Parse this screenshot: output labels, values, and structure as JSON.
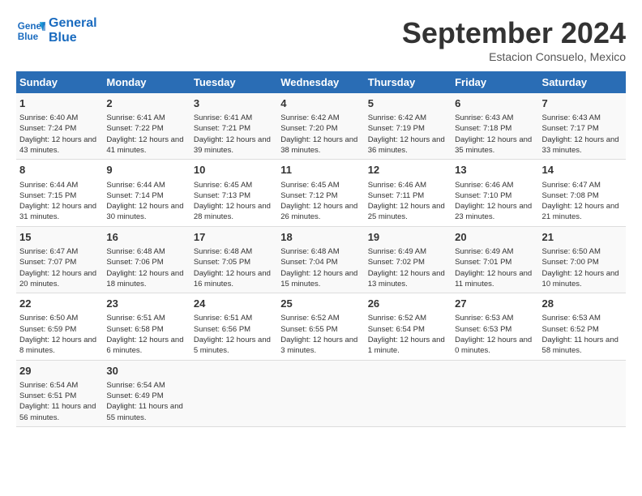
{
  "header": {
    "logo_line1": "General",
    "logo_line2": "Blue",
    "month": "September 2024",
    "location": "Estacion Consuelo, Mexico"
  },
  "weekdays": [
    "Sunday",
    "Monday",
    "Tuesday",
    "Wednesday",
    "Thursday",
    "Friday",
    "Saturday"
  ],
  "weeks": [
    [
      {
        "day": "1",
        "sunrise": "Sunrise: 6:40 AM",
        "sunset": "Sunset: 7:24 PM",
        "daylight": "Daylight: 12 hours and 43 minutes."
      },
      {
        "day": "2",
        "sunrise": "Sunrise: 6:41 AM",
        "sunset": "Sunset: 7:22 PM",
        "daylight": "Daylight: 12 hours and 41 minutes."
      },
      {
        "day": "3",
        "sunrise": "Sunrise: 6:41 AM",
        "sunset": "Sunset: 7:21 PM",
        "daylight": "Daylight: 12 hours and 39 minutes."
      },
      {
        "day": "4",
        "sunrise": "Sunrise: 6:42 AM",
        "sunset": "Sunset: 7:20 PM",
        "daylight": "Daylight: 12 hours and 38 minutes."
      },
      {
        "day": "5",
        "sunrise": "Sunrise: 6:42 AM",
        "sunset": "Sunset: 7:19 PM",
        "daylight": "Daylight: 12 hours and 36 minutes."
      },
      {
        "day": "6",
        "sunrise": "Sunrise: 6:43 AM",
        "sunset": "Sunset: 7:18 PM",
        "daylight": "Daylight: 12 hours and 35 minutes."
      },
      {
        "day": "7",
        "sunrise": "Sunrise: 6:43 AM",
        "sunset": "Sunset: 7:17 PM",
        "daylight": "Daylight: 12 hours and 33 minutes."
      }
    ],
    [
      {
        "day": "8",
        "sunrise": "Sunrise: 6:44 AM",
        "sunset": "Sunset: 7:15 PM",
        "daylight": "Daylight: 12 hours and 31 minutes."
      },
      {
        "day": "9",
        "sunrise": "Sunrise: 6:44 AM",
        "sunset": "Sunset: 7:14 PM",
        "daylight": "Daylight: 12 hours and 30 minutes."
      },
      {
        "day": "10",
        "sunrise": "Sunrise: 6:45 AM",
        "sunset": "Sunset: 7:13 PM",
        "daylight": "Daylight: 12 hours and 28 minutes."
      },
      {
        "day": "11",
        "sunrise": "Sunrise: 6:45 AM",
        "sunset": "Sunset: 7:12 PM",
        "daylight": "Daylight: 12 hours and 26 minutes."
      },
      {
        "day": "12",
        "sunrise": "Sunrise: 6:46 AM",
        "sunset": "Sunset: 7:11 PM",
        "daylight": "Daylight: 12 hours and 25 minutes."
      },
      {
        "day": "13",
        "sunrise": "Sunrise: 6:46 AM",
        "sunset": "Sunset: 7:10 PM",
        "daylight": "Daylight: 12 hours and 23 minutes."
      },
      {
        "day": "14",
        "sunrise": "Sunrise: 6:47 AM",
        "sunset": "Sunset: 7:08 PM",
        "daylight": "Daylight: 12 hours and 21 minutes."
      }
    ],
    [
      {
        "day": "15",
        "sunrise": "Sunrise: 6:47 AM",
        "sunset": "Sunset: 7:07 PM",
        "daylight": "Daylight: 12 hours and 20 minutes."
      },
      {
        "day": "16",
        "sunrise": "Sunrise: 6:48 AM",
        "sunset": "Sunset: 7:06 PM",
        "daylight": "Daylight: 12 hours and 18 minutes."
      },
      {
        "day": "17",
        "sunrise": "Sunrise: 6:48 AM",
        "sunset": "Sunset: 7:05 PM",
        "daylight": "Daylight: 12 hours and 16 minutes."
      },
      {
        "day": "18",
        "sunrise": "Sunrise: 6:48 AM",
        "sunset": "Sunset: 7:04 PM",
        "daylight": "Daylight: 12 hours and 15 minutes."
      },
      {
        "day": "19",
        "sunrise": "Sunrise: 6:49 AM",
        "sunset": "Sunset: 7:02 PM",
        "daylight": "Daylight: 12 hours and 13 minutes."
      },
      {
        "day": "20",
        "sunrise": "Sunrise: 6:49 AM",
        "sunset": "Sunset: 7:01 PM",
        "daylight": "Daylight: 12 hours and 11 minutes."
      },
      {
        "day": "21",
        "sunrise": "Sunrise: 6:50 AM",
        "sunset": "Sunset: 7:00 PM",
        "daylight": "Daylight: 12 hours and 10 minutes."
      }
    ],
    [
      {
        "day": "22",
        "sunrise": "Sunrise: 6:50 AM",
        "sunset": "Sunset: 6:59 PM",
        "daylight": "Daylight: 12 hours and 8 minutes."
      },
      {
        "day": "23",
        "sunrise": "Sunrise: 6:51 AM",
        "sunset": "Sunset: 6:58 PM",
        "daylight": "Daylight: 12 hours and 6 minutes."
      },
      {
        "day": "24",
        "sunrise": "Sunrise: 6:51 AM",
        "sunset": "Sunset: 6:56 PM",
        "daylight": "Daylight: 12 hours and 5 minutes."
      },
      {
        "day": "25",
        "sunrise": "Sunrise: 6:52 AM",
        "sunset": "Sunset: 6:55 PM",
        "daylight": "Daylight: 12 hours and 3 minutes."
      },
      {
        "day": "26",
        "sunrise": "Sunrise: 6:52 AM",
        "sunset": "Sunset: 6:54 PM",
        "daylight": "Daylight: 12 hours and 1 minute."
      },
      {
        "day": "27",
        "sunrise": "Sunrise: 6:53 AM",
        "sunset": "Sunset: 6:53 PM",
        "daylight": "Daylight: 12 hours and 0 minutes."
      },
      {
        "day": "28",
        "sunrise": "Sunrise: 6:53 AM",
        "sunset": "Sunset: 6:52 PM",
        "daylight": "Daylight: 11 hours and 58 minutes."
      }
    ],
    [
      {
        "day": "29",
        "sunrise": "Sunrise: 6:54 AM",
        "sunset": "Sunset: 6:51 PM",
        "daylight": "Daylight: 11 hours and 56 minutes."
      },
      {
        "day": "30",
        "sunrise": "Sunrise: 6:54 AM",
        "sunset": "Sunset: 6:49 PM",
        "daylight": "Daylight: 11 hours and 55 minutes."
      },
      null,
      null,
      null,
      null,
      null
    ]
  ]
}
